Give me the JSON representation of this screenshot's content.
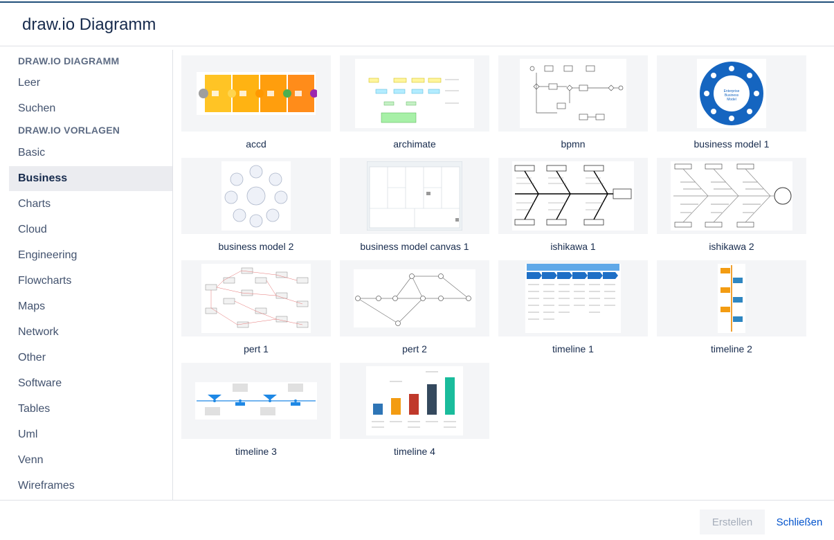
{
  "dialog": {
    "title": "draw.io Diagramm"
  },
  "sidebar": {
    "section_1": "DRAW.IO DIAGRAMM",
    "section_1_items": [
      "Leer",
      "Suchen"
    ],
    "section_2": "DRAW.IO VORLAGEN",
    "section_2_items": [
      "Basic",
      "Business",
      "Charts",
      "Cloud",
      "Engineering",
      "Flowcharts",
      "Maps",
      "Network",
      "Other",
      "Software",
      "Tables",
      "Uml",
      "Venn",
      "Wireframes"
    ],
    "selected": "Business"
  },
  "templates": [
    {
      "label": "accd",
      "icon": "accd-thumbnail"
    },
    {
      "label": "archimate",
      "icon": "archimate-thumbnail"
    },
    {
      "label": "bpmn",
      "icon": "bpmn-thumbnail"
    },
    {
      "label": "business model 1",
      "icon": "business-model-1-thumbnail"
    },
    {
      "label": "business model 2",
      "icon": "business-model-2-thumbnail"
    },
    {
      "label": "business model canvas 1",
      "icon": "business-model-canvas-thumbnail"
    },
    {
      "label": "ishikawa 1",
      "icon": "ishikawa-1-thumbnail"
    },
    {
      "label": "ishikawa 2",
      "icon": "ishikawa-2-thumbnail"
    },
    {
      "label": "pert 1",
      "icon": "pert-1-thumbnail"
    },
    {
      "label": "pert 2",
      "icon": "pert-2-thumbnail"
    },
    {
      "label": "timeline 1",
      "icon": "timeline-1-thumbnail"
    },
    {
      "label": "timeline 2",
      "icon": "timeline-2-thumbnail"
    },
    {
      "label": "timeline 3",
      "icon": "timeline-3-thumbnail"
    },
    {
      "label": "timeline 4",
      "icon": "timeline-4-thumbnail"
    }
  ],
  "footer": {
    "create_label": "Erstellen",
    "close_label": "Schließen"
  },
  "colors": {
    "accent": "#0052cc",
    "selected_bg": "#ebecf0",
    "thumb_bg": "#f4f5f7"
  }
}
